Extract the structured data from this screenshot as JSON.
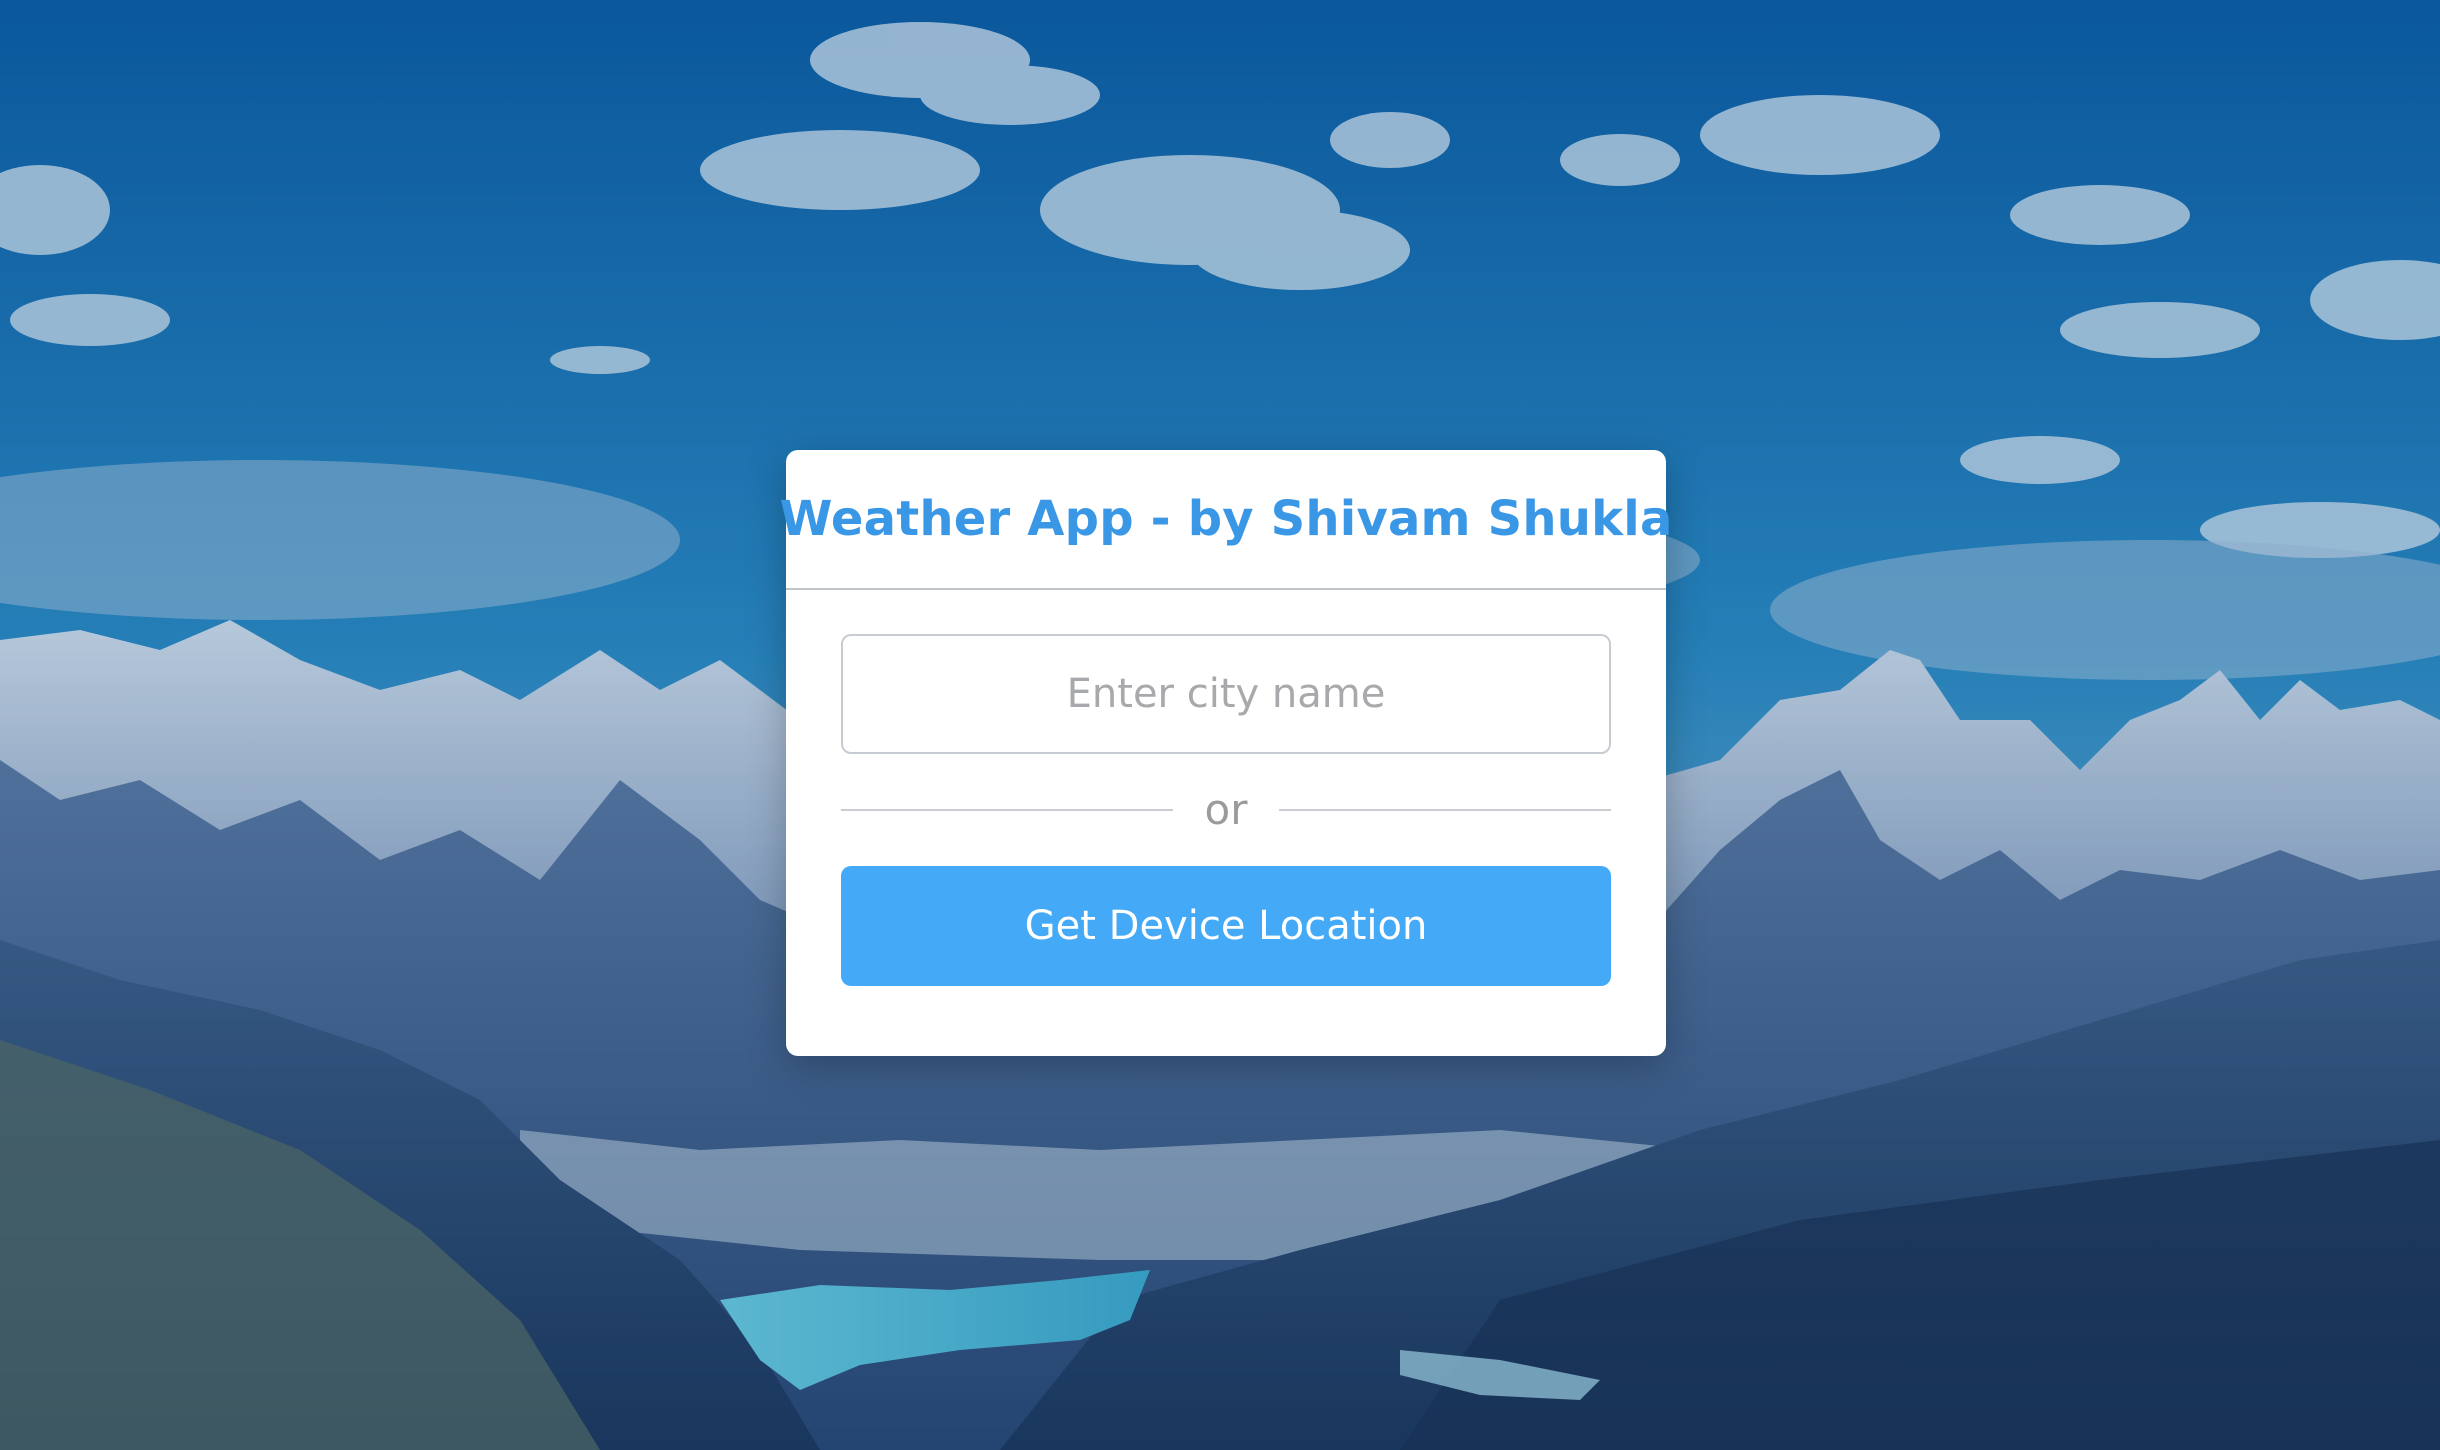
{
  "app": {
    "title": "Weather App - by Shivam Shukla"
  },
  "search": {
    "value": "",
    "placeholder": "Enter city name"
  },
  "divider": {
    "label": "or"
  },
  "location_button": {
    "label": "Get Device Location"
  },
  "colors": {
    "title": "#3a97e6",
    "button_bg": "#44aaf8",
    "button_text": "#ffffff",
    "card_bg": "#ffffff"
  }
}
